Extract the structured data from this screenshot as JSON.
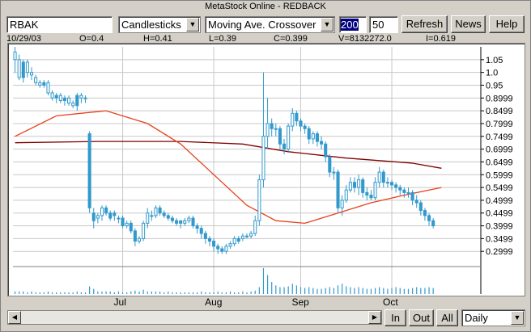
{
  "window": {
    "title": "MetaStock Online - REDBACK"
  },
  "toolbar": {
    "symbol": "RBAK",
    "chart_type": "Candlesticks",
    "study": "Moving Ave. Crossover",
    "param1": "200",
    "param2": "50",
    "refresh": "Refresh",
    "news": "News",
    "help": "Help"
  },
  "info": {
    "date": "10/29/03",
    "open": "O=0.4",
    "high": "H=0.41",
    "low": "L=0.39",
    "close": "C=0.399",
    "volume": "V=8132272.0",
    "interest": "I=0.619"
  },
  "bottom": {
    "in": "In",
    "out": "Out",
    "all": "All",
    "period": "Daily"
  },
  "colors": {
    "up": "#3399cc",
    "ma_short": "#e8401c",
    "ma_long": "#800000",
    "grid": "#c8c8c8"
  },
  "chart_data": {
    "type": "candlestick",
    "title": "",
    "xlabel": "",
    "ylabel": "",
    "y_ticks": [
      "1.05",
      "1.0",
      "0.95",
      "0.8999",
      "0.8499",
      "0.7999",
      "0.7499",
      "0.6999",
      "0.6499",
      "0.5999",
      "0.5499",
      "0.4999",
      "0.4499",
      "0.3999",
      "0.3499",
      "0.2999"
    ],
    "x_ticks": [
      {
        "label": "Jul",
        "i": 26
      },
      {
        "label": "Aug",
        "i": 48
      },
      {
        "label": "Sep",
        "i": 69
      },
      {
        "label": "Oct",
        "i": 91
      }
    ],
    "ylim": [
      0.25,
      1.1
    ],
    "grid": true,
    "series": [
      {
        "type": "candlestick",
        "x": [
          0,
          1,
          2,
          3,
          4,
          5,
          6,
          7,
          8,
          9,
          10,
          11,
          12,
          13,
          14,
          15,
          16,
          17,
          18,
          19,
          20,
          21,
          22,
          23,
          24,
          25,
          26,
          27,
          28,
          29,
          30,
          31,
          32,
          33,
          34,
          35,
          36,
          37,
          38,
          39,
          40,
          41,
          42,
          43,
          44,
          45,
          46,
          47,
          48,
          49,
          50,
          51,
          52,
          53,
          54,
          55,
          56,
          57,
          58,
          59,
          60,
          61,
          62,
          63,
          64,
          65,
          66,
          67,
          68,
          69,
          70,
          71,
          72,
          73,
          74,
          75,
          76,
          77,
          78,
          79,
          80,
          81,
          82,
          83,
          84,
          85,
          86,
          87,
          88,
          89,
          90,
          91,
          92,
          93,
          94,
          95,
          96,
          97,
          98,
          99,
          100,
          101,
          102,
          103,
          104,
          105,
          106,
          107,
          108,
          109,
          110,
          111,
          112
        ],
        "open": [
          1.05,
          0.98,
          1.04,
          1.0,
          0.99,
          0.96,
          0.95,
          0.96,
          0.92,
          0.9,
          0.91,
          0.89,
          0.9,
          0.88,
          0.87,
          0.91,
          0.9,
          0.9,
          0.76,
          0.45,
          0.43,
          0.44,
          0.47,
          0.45,
          0.45,
          0.43,
          0.43,
          0.4,
          0.41,
          0.38,
          0.34,
          0.35,
          0.41,
          0.44,
          0.44,
          0.47,
          0.45,
          0.44,
          0.43,
          0.42,
          0.42,
          0.41,
          0.42,
          0.43,
          0.4,
          0.39,
          0.37,
          0.35,
          0.34,
          0.32,
          0.31,
          0.3,
          0.32,
          0.33,
          0.35,
          0.35,
          0.36,
          0.36,
          0.37,
          0.42,
          0.58,
          0.75,
          0.8,
          0.78,
          0.78,
          0.72,
          0.7,
          0.79,
          0.84,
          0.81,
          0.79,
          0.78,
          0.74,
          0.76,
          0.73,
          0.72,
          0.67,
          0.61,
          0.61,
          0.47,
          0.5,
          0.54,
          0.57,
          0.55,
          0.58,
          0.53,
          0.52,
          0.51,
          0.57,
          0.61,
          0.57,
          0.57,
          0.56,
          0.55,
          0.54,
          0.53,
          0.53,
          0.5,
          0.49,
          0.46,
          0.44,
          0.42
        ],
        "close": [
          1.08,
          1.05,
          0.98,
          1.04,
          1.0,
          0.98,
          0.96,
          0.95,
          0.96,
          0.92,
          0.9,
          0.91,
          0.89,
          0.9,
          0.88,
          0.87,
          0.91,
          0.9,
          0.47,
          0.42,
          0.44,
          0.47,
          0.45,
          0.43,
          0.44,
          0.43,
          0.4,
          0.41,
          0.38,
          0.34,
          0.35,
          0.41,
          0.45,
          0.44,
          0.47,
          0.45,
          0.44,
          0.43,
          0.42,
          0.41,
          0.41,
          0.42,
          0.43,
          0.4,
          0.39,
          0.37,
          0.35,
          0.34,
          0.32,
          0.31,
          0.3,
          0.32,
          0.33,
          0.35,
          0.34,
          0.36,
          0.36,
          0.37,
          0.42,
          0.58,
          0.75,
          0.8,
          0.78,
          0.78,
          0.72,
          0.7,
          0.79,
          0.84,
          0.81,
          0.79,
          0.78,
          0.74,
          0.76,
          0.73,
          0.72,
          0.67,
          0.61,
          0.61,
          0.47,
          0.5,
          0.54,
          0.57,
          0.55,
          0.58,
          0.53,
          0.52,
          0.51,
          0.57,
          0.61,
          0.57,
          0.57,
          0.56,
          0.55,
          0.54,
          0.53,
          0.53,
          0.5,
          0.49,
          0.46,
          0.44,
          0.42,
          0.4
        ],
        "high": [
          1.1,
          1.07,
          1.05,
          1.05,
          1.02,
          0.99,
          0.97,
          0.97,
          0.97,
          0.93,
          0.92,
          0.92,
          0.91,
          0.91,
          0.89,
          0.92,
          0.92,
          0.91,
          0.77,
          0.47,
          0.45,
          0.48,
          0.48,
          0.46,
          0.46,
          0.44,
          0.44,
          0.42,
          0.42,
          0.39,
          0.36,
          0.42,
          0.47,
          0.46,
          0.48,
          0.48,
          0.46,
          0.45,
          0.44,
          0.43,
          0.42,
          0.43,
          0.44,
          0.44,
          0.41,
          0.4,
          0.38,
          0.36,
          0.35,
          0.33,
          0.32,
          0.33,
          0.34,
          0.36,
          0.36,
          0.37,
          0.37,
          0.38,
          0.44,
          0.6,
          1.0,
          0.9,
          0.82,
          0.8,
          0.79,
          0.74,
          0.8,
          0.86,
          0.85,
          0.82,
          0.8,
          0.79,
          0.77,
          0.77,
          0.75,
          0.73,
          0.68,
          0.63,
          0.62,
          0.52,
          0.56,
          0.59,
          0.59,
          0.6,
          0.59,
          0.55,
          0.54,
          0.59,
          0.63,
          0.62,
          0.59,
          0.58,
          0.57,
          0.56,
          0.55,
          0.55,
          0.54,
          0.52,
          0.5,
          0.47,
          0.45,
          0.43
        ],
        "low": [
          1.0,
          0.97,
          0.96,
          0.98,
          0.97,
          0.95,
          0.94,
          0.94,
          0.91,
          0.89,
          0.88,
          0.88,
          0.87,
          0.87,
          0.86,
          0.85,
          0.88,
          0.88,
          0.45,
          0.39,
          0.41,
          0.42,
          0.44,
          0.42,
          0.42,
          0.41,
          0.39,
          0.39,
          0.37,
          0.32,
          0.33,
          0.34,
          0.39,
          0.42,
          0.43,
          0.44,
          0.43,
          0.42,
          0.41,
          0.4,
          0.39,
          0.4,
          0.41,
          0.39,
          0.37,
          0.35,
          0.33,
          0.32,
          0.3,
          0.29,
          0.29,
          0.29,
          0.31,
          0.32,
          0.33,
          0.34,
          0.35,
          0.35,
          0.36,
          0.4,
          0.55,
          0.7,
          0.75,
          0.75,
          0.7,
          0.68,
          0.69,
          0.77,
          0.79,
          0.77,
          0.76,
          0.72,
          0.72,
          0.71,
          0.7,
          0.65,
          0.59,
          0.58,
          0.45,
          0.44,
          0.49,
          0.53,
          0.53,
          0.52,
          0.51,
          0.5,
          0.5,
          0.5,
          0.55,
          0.55,
          0.55,
          0.54,
          0.53,
          0.52,
          0.51,
          0.51,
          0.48,
          0.47,
          0.44,
          0.42,
          0.4,
          0.39
        ]
      },
      {
        "type": "line",
        "name": "",
        "values_at": [
          [
            0,
            0.75
          ],
          [
            10,
            0.83
          ],
          [
            22,
            0.85
          ],
          [
            32,
            0.8
          ],
          [
            40,
            0.72
          ],
          [
            48,
            0.6
          ],
          [
            56,
            0.48
          ],
          [
            63,
            0.42
          ],
          [
            70,
            0.41
          ],
          [
            78,
            0.45
          ],
          [
            86,
            0.49
          ],
          [
            94,
            0.52
          ],
          [
            103,
            0.55
          ]
        ]
      },
      {
        "type": "line",
        "name": "",
        "values_at": [
          [
            0,
            0.725
          ],
          [
            20,
            0.73
          ],
          [
            40,
            0.73
          ],
          [
            55,
            0.72
          ],
          [
            66,
            0.69
          ],
          [
            80,
            0.665
          ],
          [
            96,
            0.645
          ],
          [
            103,
            0.625
          ]
        ]
      }
    ],
    "volume": [
      3,
      3,
      3,
      2,
      3,
      2,
      2,
      2,
      3,
      2,
      2,
      2,
      2,
      2,
      2,
      3,
      2,
      2,
      9,
      6,
      3,
      3,
      3,
      3,
      2,
      3,
      2,
      2,
      3,
      4,
      3,
      5,
      3,
      3,
      3,
      3,
      2,
      3,
      2,
      2,
      2,
      2,
      2,
      2,
      2,
      3,
      2,
      2,
      2,
      3,
      2,
      2,
      3,
      2,
      2,
      3,
      2,
      3,
      4,
      8,
      30,
      22,
      14,
      10,
      8,
      8,
      9,
      12,
      10,
      8,
      7,
      8,
      7,
      6,
      6,
      7,
      8,
      7,
      10,
      12,
      9,
      8,
      7,
      8,
      7,
      6,
      6,
      7,
      8,
      7,
      6,
      7,
      8,
      7,
      6,
      6,
      7,
      8,
      7,
      7,
      8,
      7
    ]
  }
}
